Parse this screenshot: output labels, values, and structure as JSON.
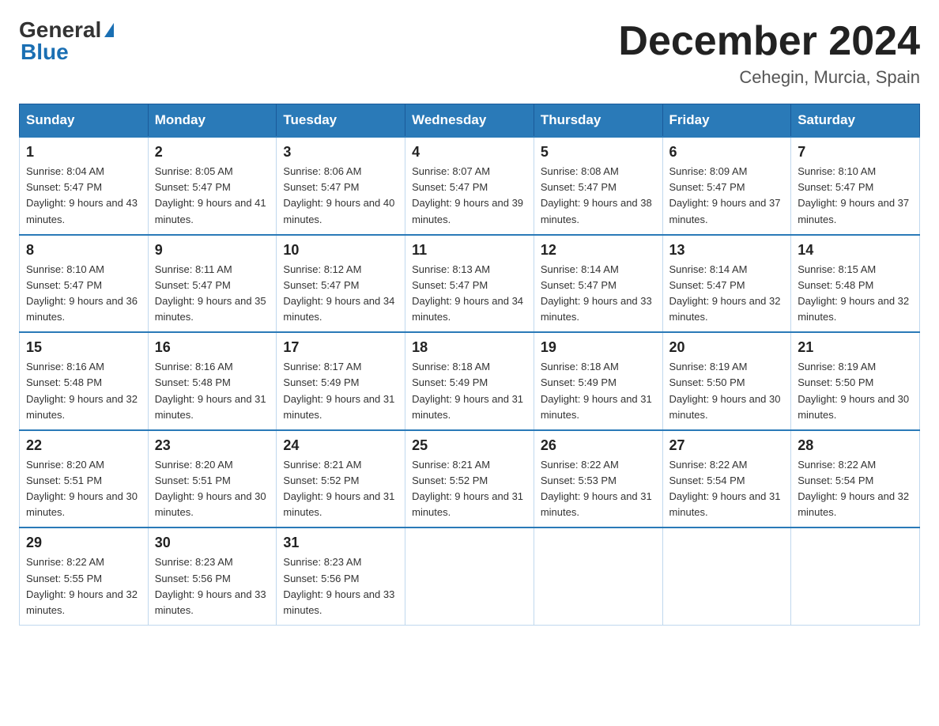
{
  "header": {
    "logo_general": "General",
    "logo_blue": "Blue",
    "month_title": "December 2024",
    "location": "Cehegin, Murcia, Spain"
  },
  "calendar": {
    "days_of_week": [
      "Sunday",
      "Monday",
      "Tuesday",
      "Wednesday",
      "Thursday",
      "Friday",
      "Saturday"
    ],
    "weeks": [
      [
        {
          "day": "1",
          "sunrise": "8:04 AM",
          "sunset": "5:47 PM",
          "daylight": "9 hours and 43 minutes."
        },
        {
          "day": "2",
          "sunrise": "8:05 AM",
          "sunset": "5:47 PM",
          "daylight": "9 hours and 41 minutes."
        },
        {
          "day": "3",
          "sunrise": "8:06 AM",
          "sunset": "5:47 PM",
          "daylight": "9 hours and 40 minutes."
        },
        {
          "day": "4",
          "sunrise": "8:07 AM",
          "sunset": "5:47 PM",
          "daylight": "9 hours and 39 minutes."
        },
        {
          "day": "5",
          "sunrise": "8:08 AM",
          "sunset": "5:47 PM",
          "daylight": "9 hours and 38 minutes."
        },
        {
          "day": "6",
          "sunrise": "8:09 AM",
          "sunset": "5:47 PM",
          "daylight": "9 hours and 37 minutes."
        },
        {
          "day": "7",
          "sunrise": "8:10 AM",
          "sunset": "5:47 PM",
          "daylight": "9 hours and 37 minutes."
        }
      ],
      [
        {
          "day": "8",
          "sunrise": "8:10 AM",
          "sunset": "5:47 PM",
          "daylight": "9 hours and 36 minutes."
        },
        {
          "day": "9",
          "sunrise": "8:11 AM",
          "sunset": "5:47 PM",
          "daylight": "9 hours and 35 minutes."
        },
        {
          "day": "10",
          "sunrise": "8:12 AM",
          "sunset": "5:47 PM",
          "daylight": "9 hours and 34 minutes."
        },
        {
          "day": "11",
          "sunrise": "8:13 AM",
          "sunset": "5:47 PM",
          "daylight": "9 hours and 34 minutes."
        },
        {
          "day": "12",
          "sunrise": "8:14 AM",
          "sunset": "5:47 PM",
          "daylight": "9 hours and 33 minutes."
        },
        {
          "day": "13",
          "sunrise": "8:14 AM",
          "sunset": "5:47 PM",
          "daylight": "9 hours and 32 minutes."
        },
        {
          "day": "14",
          "sunrise": "8:15 AM",
          "sunset": "5:48 PM",
          "daylight": "9 hours and 32 minutes."
        }
      ],
      [
        {
          "day": "15",
          "sunrise": "8:16 AM",
          "sunset": "5:48 PM",
          "daylight": "9 hours and 32 minutes."
        },
        {
          "day": "16",
          "sunrise": "8:16 AM",
          "sunset": "5:48 PM",
          "daylight": "9 hours and 31 minutes."
        },
        {
          "day": "17",
          "sunrise": "8:17 AM",
          "sunset": "5:49 PM",
          "daylight": "9 hours and 31 minutes."
        },
        {
          "day": "18",
          "sunrise": "8:18 AM",
          "sunset": "5:49 PM",
          "daylight": "9 hours and 31 minutes."
        },
        {
          "day": "19",
          "sunrise": "8:18 AM",
          "sunset": "5:49 PM",
          "daylight": "9 hours and 31 minutes."
        },
        {
          "day": "20",
          "sunrise": "8:19 AM",
          "sunset": "5:50 PM",
          "daylight": "9 hours and 30 minutes."
        },
        {
          "day": "21",
          "sunrise": "8:19 AM",
          "sunset": "5:50 PM",
          "daylight": "9 hours and 30 minutes."
        }
      ],
      [
        {
          "day": "22",
          "sunrise": "8:20 AM",
          "sunset": "5:51 PM",
          "daylight": "9 hours and 30 minutes."
        },
        {
          "day": "23",
          "sunrise": "8:20 AM",
          "sunset": "5:51 PM",
          "daylight": "9 hours and 30 minutes."
        },
        {
          "day": "24",
          "sunrise": "8:21 AM",
          "sunset": "5:52 PM",
          "daylight": "9 hours and 31 minutes."
        },
        {
          "day": "25",
          "sunrise": "8:21 AM",
          "sunset": "5:52 PM",
          "daylight": "9 hours and 31 minutes."
        },
        {
          "day": "26",
          "sunrise": "8:22 AM",
          "sunset": "5:53 PM",
          "daylight": "9 hours and 31 minutes."
        },
        {
          "day": "27",
          "sunrise": "8:22 AM",
          "sunset": "5:54 PM",
          "daylight": "9 hours and 31 minutes."
        },
        {
          "day": "28",
          "sunrise": "8:22 AM",
          "sunset": "5:54 PM",
          "daylight": "9 hours and 32 minutes."
        }
      ],
      [
        {
          "day": "29",
          "sunrise": "8:22 AM",
          "sunset": "5:55 PM",
          "daylight": "9 hours and 32 minutes."
        },
        {
          "day": "30",
          "sunrise": "8:23 AM",
          "sunset": "5:56 PM",
          "daylight": "9 hours and 33 minutes."
        },
        {
          "day": "31",
          "sunrise": "8:23 AM",
          "sunset": "5:56 PM",
          "daylight": "9 hours and 33 minutes."
        },
        null,
        null,
        null,
        null
      ]
    ]
  }
}
